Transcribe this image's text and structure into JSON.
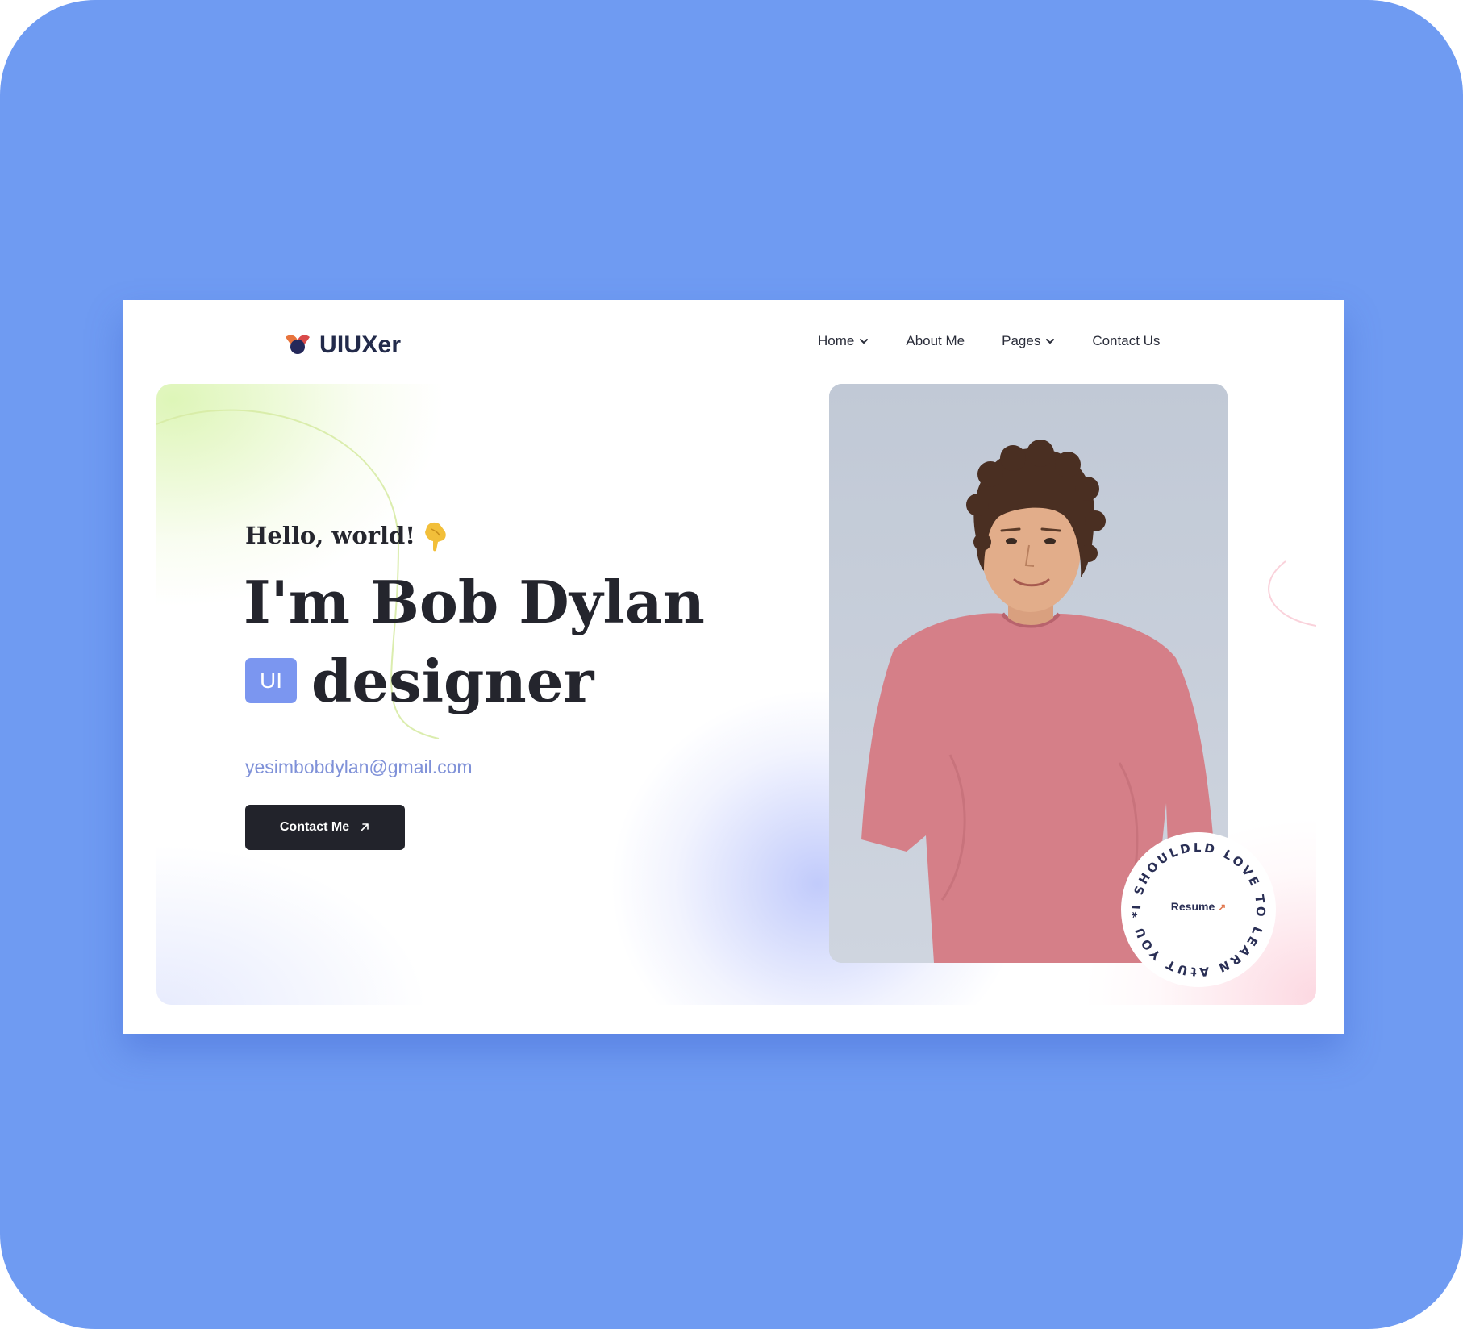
{
  "brand": {
    "name": "UIUXer"
  },
  "nav": {
    "items": [
      {
        "label": "Home",
        "has_dropdown": true
      },
      {
        "label": "About Me",
        "has_dropdown": false
      },
      {
        "label": "Pages",
        "has_dropdown": true
      },
      {
        "label": "Contact Us",
        "has_dropdown": false
      }
    ]
  },
  "hero": {
    "greeting": "Hello, world!",
    "headline": "I'm Bob Dylan",
    "role_badge": "UI",
    "role": "designer",
    "email": "yesimbobdylan@gmail.com",
    "cta_label": "Contact Me"
  },
  "seal": {
    "ring_text": "I SHOULDLD LOVE TO LEARN AtUT YOU *",
    "label": "Resume"
  },
  "colors": {
    "frame_background": "#6f9bf2",
    "accent": "#7b96f0",
    "button": "#22232b",
    "shirt": "#d57f88",
    "photo_background": "#c4ccd8"
  },
  "icons": {
    "logo": "logo-mark-icon",
    "greeting": "pointing-hand-icon",
    "dropdown": "chevron-down-icon",
    "cta": "arrow-up-right-icon"
  }
}
